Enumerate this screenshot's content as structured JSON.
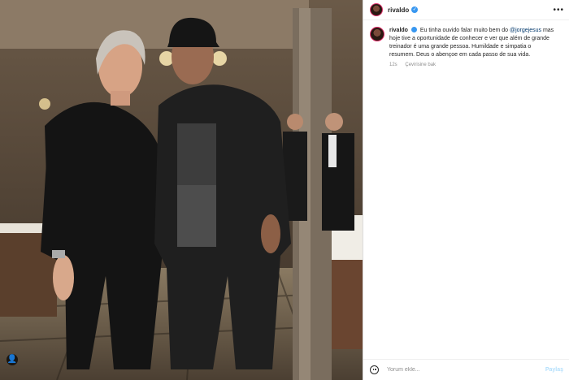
{
  "post": {
    "username": "rivaldo",
    "verified_mark": "✓",
    "more_label": "•••",
    "caption": {
      "username": "rivaldo",
      "text_before": "Eu tinha ouvido falar muito bem do ",
      "mention": "@jorgejesus",
      "text_after": " mas hoje tive a oportunidade de conhecer e ver que além de grande treinador é uma grande pessoa. Humildade e simpatia o resumem. Deus o abençoe em cada passo de sua vida.",
      "time": "12s",
      "translate": "Çevirisine bak"
    },
    "comment": {
      "placeholder": "Yorum ekle...",
      "post_label": "Paylaş"
    },
    "tag_icon": "person-tag-icon",
    "tag_glyph": "👤"
  },
  "colors": {
    "verified": "#3897f0",
    "mention": "#00376b",
    "post_button": "#b2dffc"
  }
}
